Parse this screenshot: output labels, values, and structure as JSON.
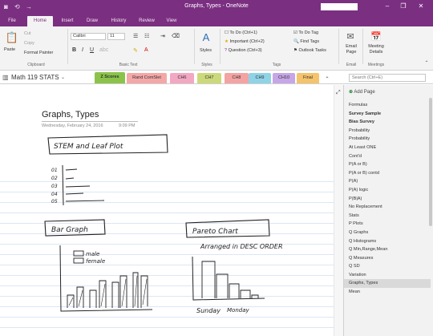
{
  "window": {
    "title": "Graphs, Types - OneNote",
    "controls": [
      "–",
      "❐",
      "✕"
    ]
  },
  "ribbon_tabs": [
    "File",
    "Home",
    "Insert",
    "Draw",
    "History",
    "Review",
    "View"
  ],
  "ribbon": {
    "paste": "Paste",
    "cut": "Cut",
    "copy": "Copy",
    "format_painter": "Format Painter",
    "clipboard": "Clipboard",
    "font": "Calibri",
    "size": "11",
    "basic_text": "Basic Text",
    "styles": "Styles",
    "styles_group": "Styles",
    "todo": "To Do (Ctrl+1)",
    "important": "Important (Ctrl+2)",
    "question": "Question (Ctrl+3)",
    "tags_group": "Tags",
    "todo_tag": "To Do Tag",
    "find_tags": "Find Tags",
    "outlook_tasks": "Outlook Tasks",
    "email_page": "Email Page",
    "email_group": "Email",
    "meeting_details": "Meeting Details",
    "meetings_group": "Meetings"
  },
  "notebook": {
    "name": "Math 119 STATS",
    "sections": [
      {
        "label": "Z Scores",
        "color": "#8bc34a"
      },
      {
        "label": "Rand ComSlet",
        "color": "#f4a7a7"
      },
      {
        "label": "CH6",
        "color": "#f2a8c2"
      },
      {
        "label": "CH7",
        "color": "#ccd97a"
      },
      {
        "label": "CH8",
        "color": "#f4a3a3"
      },
      {
        "label": "CH9",
        "color": "#8fd3e6"
      },
      {
        "label": "CH10",
        "color": "#c6a6e6"
      },
      {
        "label": "Final",
        "color": "#f4c36b"
      }
    ],
    "add_section": "+",
    "search_placeholder": "Search (Ctrl+E)"
  },
  "page": {
    "title": "Graphs, Types",
    "date": "Wednesday, February 24, 2016",
    "time": "9:09 PM"
  },
  "ink_text": {
    "stem": "STEM and Leaf Plot",
    "stems": [
      "01",
      "02",
      "03",
      "04",
      "05"
    ],
    "bar": "Bar Graph",
    "male": "male",
    "female": "female",
    "pareto": "Pareto Chart",
    "arranged": "Arranged in DESC ORDER",
    "sunday": "Sunday",
    "monday": "Monday"
  },
  "pages_pane": {
    "add_page": "Add Page",
    "pages": [
      "Formulas",
      "Survey Sample",
      "Bias Survey",
      "Probability",
      "Probability",
      "At Least ONE",
      "Cont'd",
      "P(A or B)",
      "P(A or B) contd",
      "P(A)",
      "P(A) logic",
      "P(B|A)",
      "No Replacement",
      "Stats",
      "P Plots",
      "Q Graphs",
      "Q Histograms",
      "Q Min,Range,Mean",
      "Q Measures",
      "Q SD",
      "Variation",
      "Graphs, Types",
      "Mean"
    ],
    "selected_index": 21,
    "bold_indices": [
      1,
      2
    ]
  },
  "icons": {
    "app": "onenote-icon",
    "back": "back-arrow-icon",
    "forward": "forward-arrow-icon",
    "expand": "expand-icon",
    "add": "plus-icon"
  }
}
